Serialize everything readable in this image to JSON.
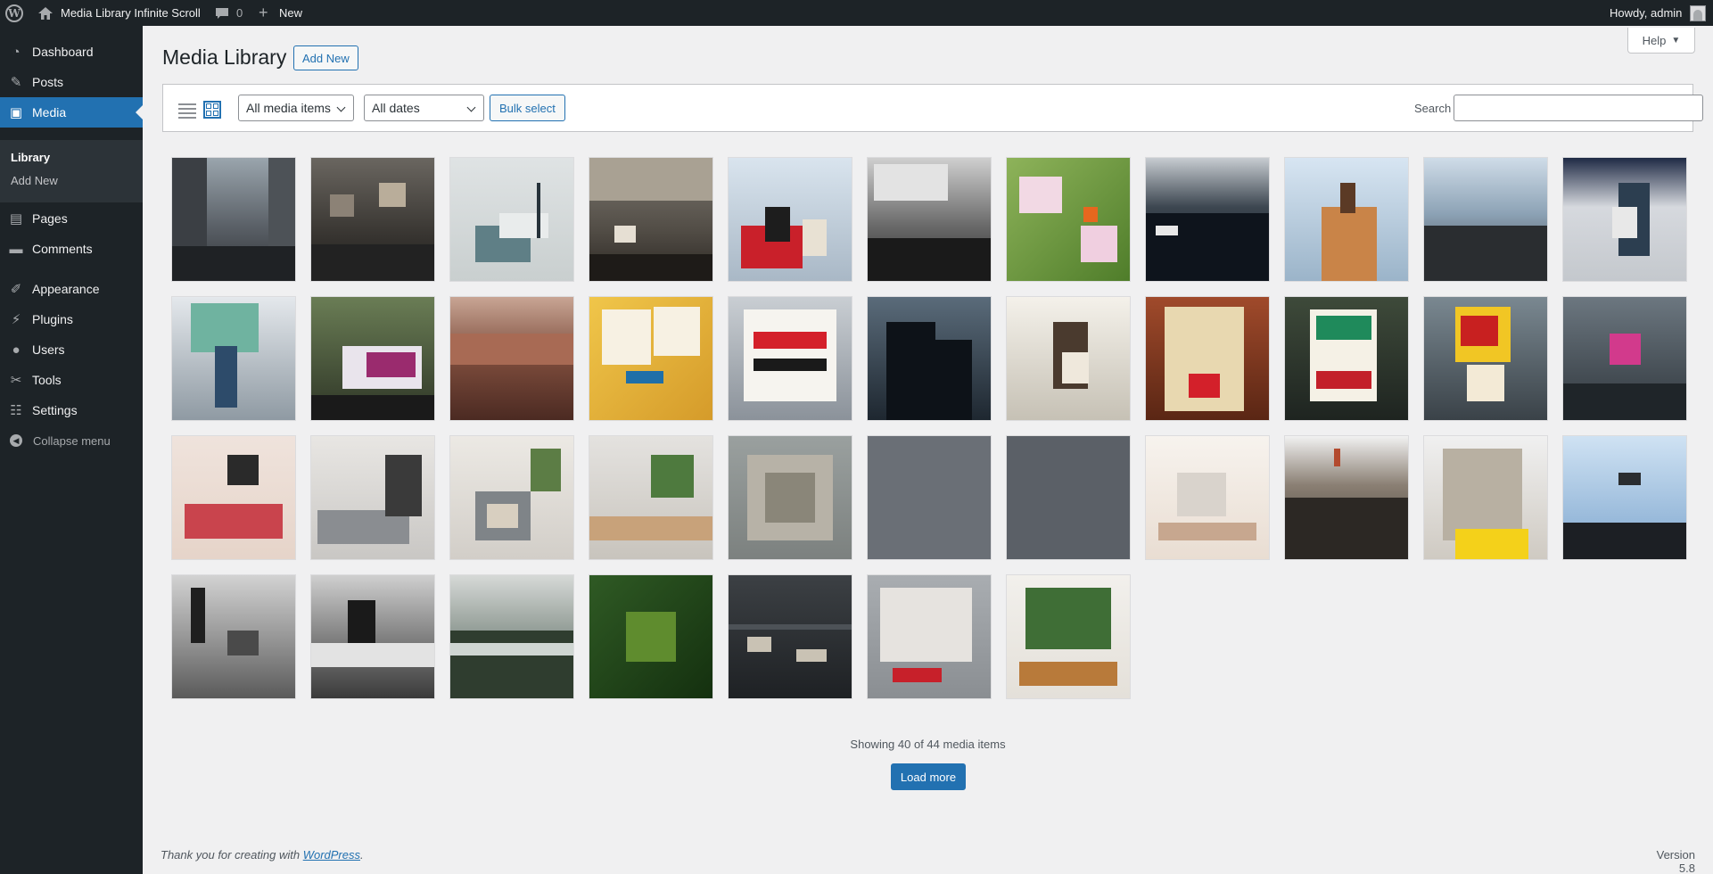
{
  "adminbar": {
    "site_name": "Media Library Infinite Scroll",
    "comments_count": "0",
    "new_label": "New",
    "howdy": "Howdy, admin"
  },
  "sidebar": {
    "items": [
      {
        "label": "Dashboard",
        "icon": "dashboard-icon",
        "glyph": "◔"
      },
      {
        "label": "Posts",
        "icon": "pushpin-icon",
        "glyph": "✎"
      },
      {
        "label": "Media",
        "icon": "media-icon",
        "glyph": "▣"
      },
      {
        "label": "Pages",
        "icon": "pages-icon",
        "glyph": "▤"
      },
      {
        "label": "Comments",
        "icon": "comments-icon",
        "glyph": "▬"
      },
      {
        "label": "Appearance",
        "icon": "paintbrush-icon",
        "glyph": "✐"
      },
      {
        "label": "Plugins",
        "icon": "plugins-icon",
        "glyph": "⚡"
      },
      {
        "label": "Users",
        "icon": "users-icon",
        "glyph": "●"
      },
      {
        "label": "Tools",
        "icon": "wrench-icon",
        "glyph": "✂"
      },
      {
        "label": "Settings",
        "icon": "settings-icon",
        "glyph": "☷"
      }
    ],
    "submenu": [
      "Library",
      "Add New"
    ],
    "collapse_label": "Collapse menu"
  },
  "header": {
    "help_label": "Help",
    "title": "Media Library",
    "add_new_label": "Add New"
  },
  "toolbar": {
    "type_filter": "All media items",
    "date_filter": "All dates",
    "bulk_select_label": "Bulk select",
    "search_label": "Search",
    "search_value": ""
  },
  "media_items": [
    "city-street-crowd",
    "protest-signs-crowd",
    "modern-interior-lamp",
    "protest-building-signs",
    "red-flag-protest",
    "black-lives-matter-bw",
    "bird-on-blossom-branch",
    "police-line",
    "woman-raised-fist",
    "crowd-blue-sky",
    "man-with-backpack",
    "rainbow-umbrella",
    "refugees-welcome-banner",
    "grand-canyon",
    "plastic-fish-sign",
    "nur-totalitaere-staaten-sign",
    "riot-police-street",
    "protester-back-sign",
    "wake-up-sign",
    "climate-justice-or-riot",
    "stop-talking-sign",
    "pink-flag-crowd",
    "red-sofa-room",
    "grey-sofa-shelves",
    "grey-armchair-plant",
    "plant-on-table",
    "aerial-rooftop",
    "stadium-crowd",
    "crowd-from-above",
    "white-horses-water",
    "protest-march",
    "dome-building",
    "helicopter-crowd",
    "smoke-figure-bw",
    "teargas-bw",
    "foggy-forest",
    "aerial-green-forest",
    "bookshelf-dark",
    "graffiti-face",
    "potted-plants"
  ],
  "showing_text": "Showing 40 of 44 media items",
  "load_more_label": "Load more",
  "footer": {
    "thanks_text": "Thank you for creating with ",
    "link_text": "WordPress",
    "version": "Version 5.8"
  }
}
